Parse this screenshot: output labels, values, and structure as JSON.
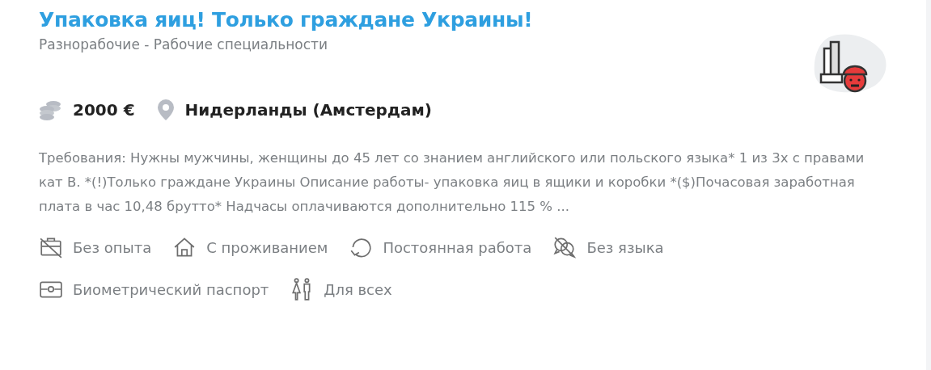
{
  "title": "Упаковка яиц! Только граждане Украины!",
  "category": "Разнорабочие - Рабочие специальности",
  "salary": "2000 €",
  "location": "Нидерланды (Амстердам)",
  "description": "Требования: Нужны мужчины, женщины до 45 лет со знанием английского или польского языка* 1 из 3х с правами кат B. *(!)Только граждане Украины Описание работы- упаковка яиц в ящики и коробки *($)Почасовая заработная плата в час 10,48 брутто* Надчасы оплачиваются дополнительно 115 % ...",
  "tag_rows": [
    [
      {
        "kind": "no-experience",
        "label": "Без опыта"
      },
      {
        "kind": "housing",
        "label": "С проживанием"
      },
      {
        "kind": "permanent",
        "label": "Постоянная работа"
      },
      {
        "kind": "no-language",
        "label": "Без языка"
      }
    ],
    [
      {
        "kind": "passport",
        "label": "Биометрический паспорт"
      },
      {
        "kind": "everyone",
        "label": "Для всех"
      }
    ]
  ]
}
